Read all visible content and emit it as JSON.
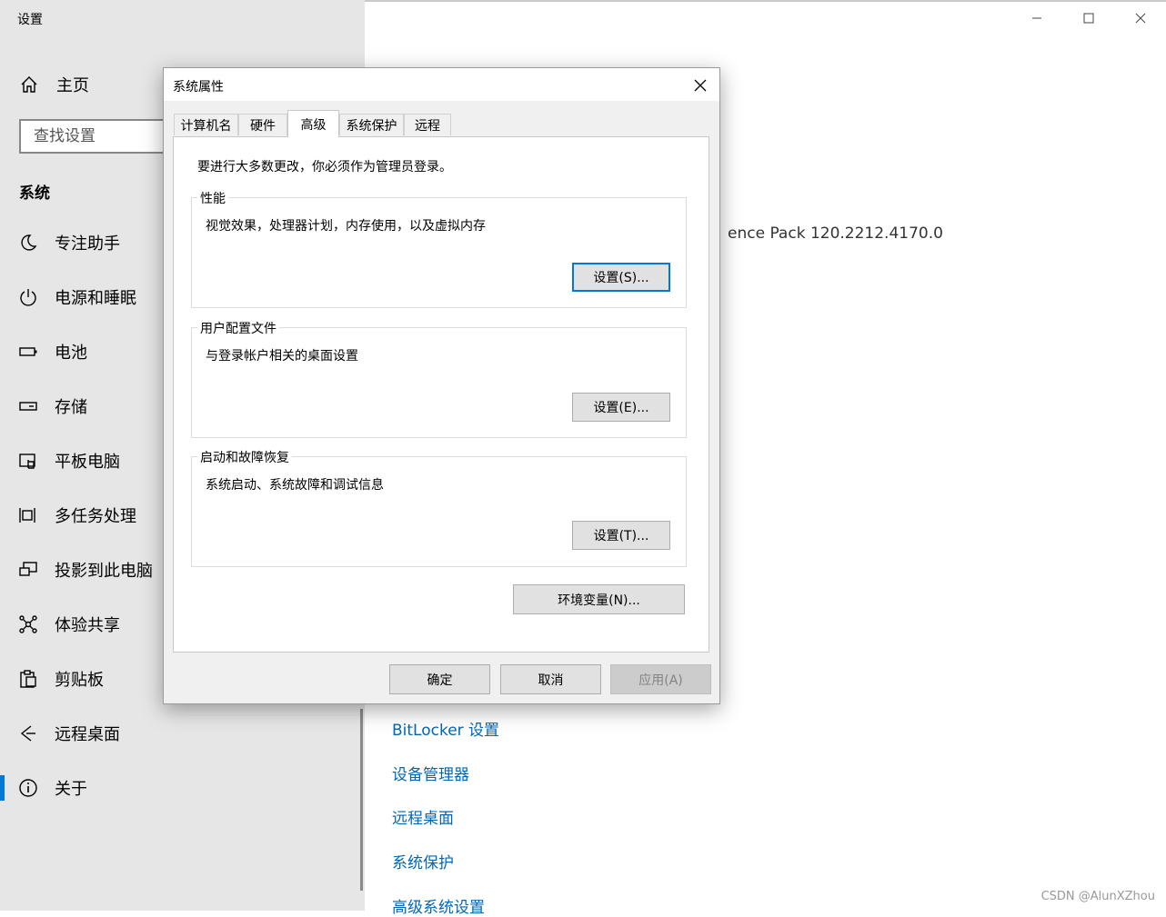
{
  "window": {
    "title": "设置"
  },
  "sidebar": {
    "home_label": "主页",
    "search_placeholder": "查找设置",
    "section_heading": "系统",
    "items": [
      {
        "label": "专注助手",
        "icon": "moon-icon"
      },
      {
        "label": "电源和睡眠",
        "icon": "power-icon"
      },
      {
        "label": "电池",
        "icon": "battery-icon"
      },
      {
        "label": "存储",
        "icon": "storage-icon"
      },
      {
        "label": "平板电脑",
        "icon": "tablet-icon"
      },
      {
        "label": "多任务处理",
        "icon": "multitask-icon"
      },
      {
        "label": "投影到此电脑",
        "icon": "project-icon"
      },
      {
        "label": "体验共享",
        "icon": "share-icon"
      },
      {
        "label": "剪贴板",
        "icon": "clipboard-icon"
      },
      {
        "label": "远程桌面",
        "icon": "remote-desktop-icon"
      },
      {
        "label": "关于",
        "icon": "info-icon",
        "active": true
      }
    ]
  },
  "content": {
    "partial_text": "ence Pack 120.2212.4170.0",
    "links": [
      "BitLocker 设置",
      "设备管理器",
      "远程桌面",
      "系统保护",
      "高级系统设置"
    ]
  },
  "dialog": {
    "title": "系统属性",
    "tabs": [
      "计算机名",
      "硬件",
      "高级",
      "系统保护",
      "远程"
    ],
    "active_tab": "高级",
    "note": "要进行大多数更改，你必须作为管理员登录。",
    "performance": {
      "title": "性能",
      "desc": "视觉效果，处理器计划，内存使用，以及虚拟内存",
      "button": "设置(S)..."
    },
    "user_profiles": {
      "title": "用户配置文件",
      "desc": "与登录帐户相关的桌面设置",
      "button": "设置(E)..."
    },
    "startup_recovery": {
      "title": "启动和故障恢复",
      "desc": "系统启动、系统故障和调试信息",
      "button": "设置(T)..."
    },
    "env_button": "环境变量(N)...",
    "ok_button": "确定",
    "cancel_button": "取消",
    "apply_button": "应用(A)"
  },
  "watermark": "CSDN @AlunXZhou",
  "colors": {
    "accent": "#0078d7",
    "link": "#0067b8",
    "sidebar_bg": "#e6e6e6"
  }
}
